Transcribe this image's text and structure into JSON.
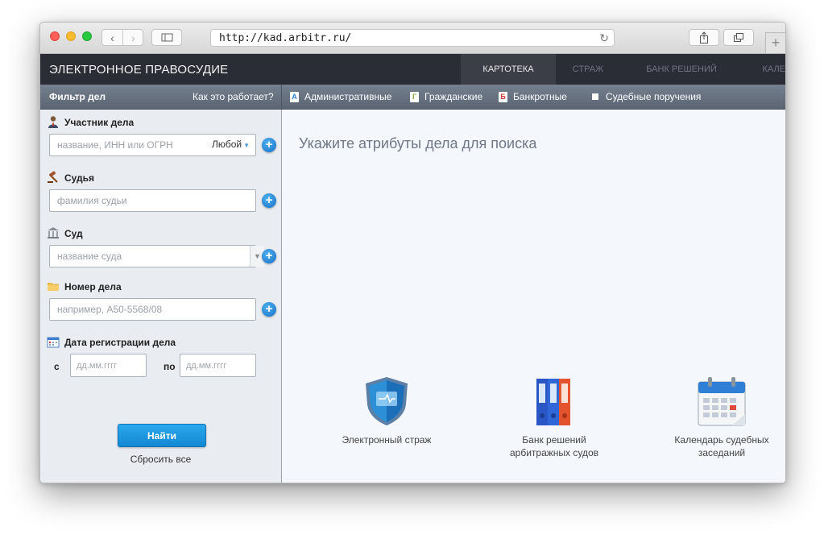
{
  "browser": {
    "url": "http://kad.arbitr.ru/"
  },
  "site": {
    "brand": "ЭЛЕКТРОННОЕ ПРАВОСУДИЕ",
    "nav": [
      {
        "label": "КАРТОТЕКА",
        "active": true
      },
      {
        "label": "СТРАЖ",
        "active": false
      },
      {
        "label": "БАНК РЕШЕНИЙ",
        "active": false
      },
      {
        "label": "КАЛЕ",
        "active": false
      }
    ]
  },
  "filterbar": {
    "title": "Фильтр дел",
    "how": "Как это работает?",
    "categories": [
      {
        "icon_letter": "А",
        "label": "Административные",
        "color": "#2f7fd0"
      },
      {
        "icon_letter": "Г",
        "label": "Гражданские",
        "color": "#7ea93b"
      },
      {
        "icon_letter": "Б",
        "label": "Банкротные",
        "color": "#d23a2f"
      },
      {
        "icon_letter": "",
        "label": "Судебные поручения",
        "color": "#ffffff"
      }
    ]
  },
  "filters": {
    "participant": {
      "label": "Участник дела",
      "placeholder": "название, ИНН или ОГРН",
      "role": "Любой"
    },
    "judge": {
      "label": "Судья",
      "placeholder": "фамилия судьи"
    },
    "court": {
      "label": "Суд",
      "placeholder": "название суда"
    },
    "case_number": {
      "label": "Номер дела",
      "placeholder": "например, А50-5568/08"
    },
    "reg_date": {
      "label": "Дата регистрации дела",
      "from_label": "с",
      "to_label": "по",
      "from_placeholder": "дд.мм.гггг",
      "to_placeholder": "дд.мм.гггг"
    },
    "find_label": "Найти",
    "reset_label": "Сбросить все"
  },
  "main": {
    "prompt": "Укажите атрибуты дела для поиска",
    "features": [
      {
        "label": "Электронный страж",
        "icon": "shield-icon"
      },
      {
        "label": "Банк решений\nарбитражных судов",
        "icon": "binders-icon"
      },
      {
        "label": "Календарь судебных\nзаседаний",
        "icon": "calendar-icon"
      }
    ]
  }
}
